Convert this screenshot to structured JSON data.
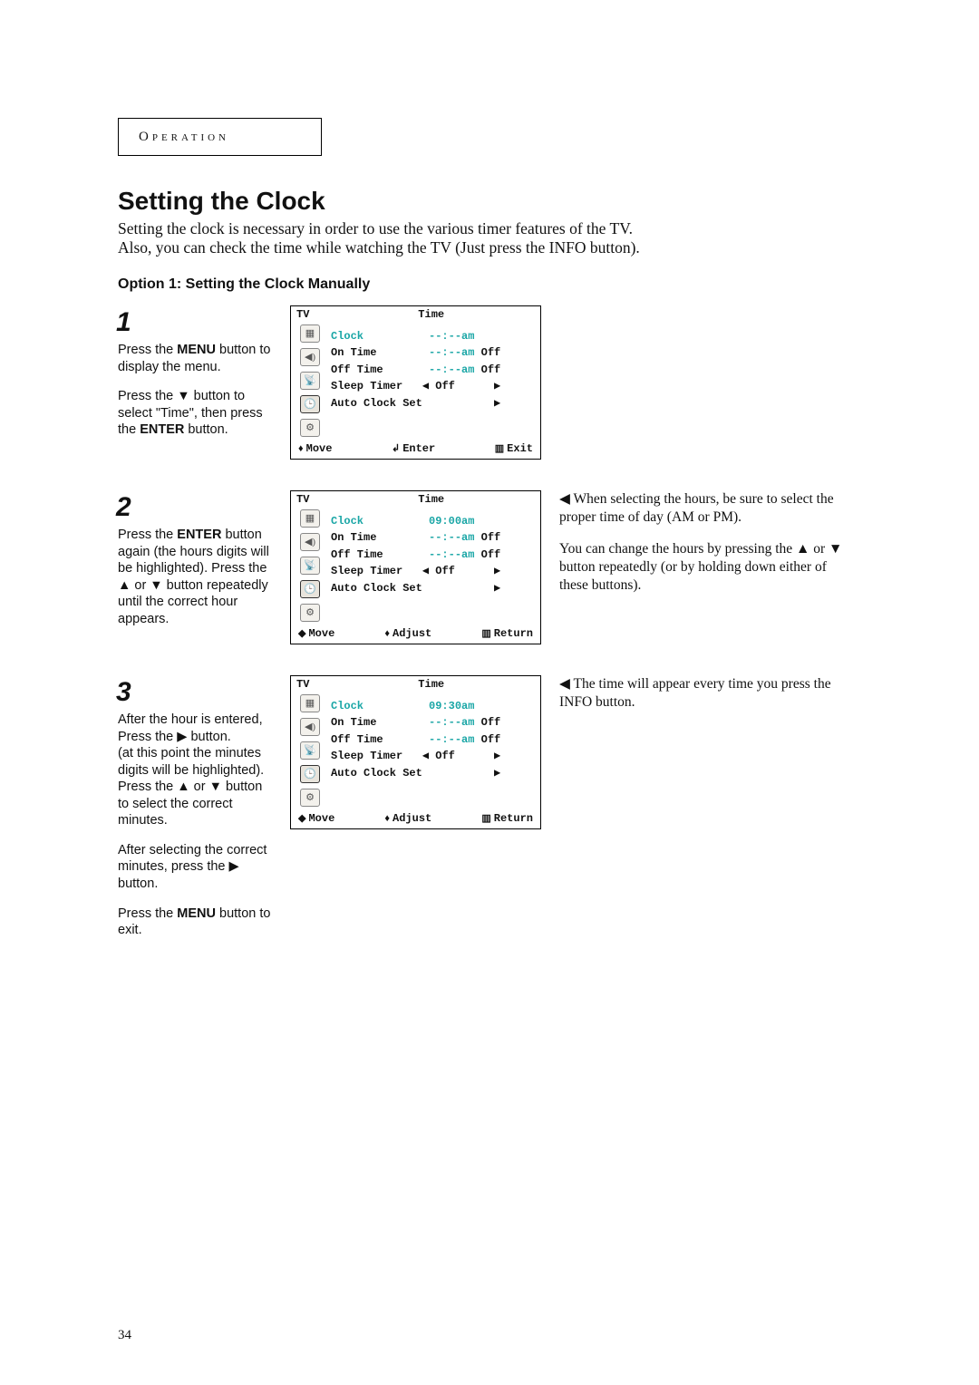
{
  "section_label": "Operation",
  "title": "Setting the Clock",
  "intro_line1": "Setting the clock is necessary in order to use the various timer features of the TV.",
  "intro_line2": "Also, you can check the time while watching the TV (Just press the INFO button).",
  "option_title": "Option 1: Setting the Clock Manually",
  "step1": {
    "num": "1",
    "p1a": "Press the ",
    "p1b": "MENU",
    "p1c": " button to display the menu.",
    "p2a": "Press the ▼ button to select \"Time\", then press the ",
    "p2b": "ENTER",
    "p2c": " button."
  },
  "osd1": {
    "tv": "TV",
    "head": "Time",
    "rows": "Clock          --:--am\nOn Time        --:--am Off\nOff Time       --:--am Off\nSleep Timer   ◀ Off      ▶\nAuto Clock Set           ▶",
    "foot_move_glyph": "♦",
    "foot_move": "Move",
    "foot_mid_glyph": "↲",
    "foot_mid": "Enter",
    "foot_right_glyph": "▥",
    "foot_right": "Exit"
  },
  "step2": {
    "num": "2",
    "p1a": "Press the ",
    "p1b": "ENTER",
    "p1c": " button again (the hours digits will be highlighted). Press the ▲ or ▼ button repeatedly until the correct hour appears."
  },
  "osd2": {
    "tv": "TV",
    "head": "Time",
    "rows": "Clock          09:00am\nOn Time        --:--am Off\nOff Time       --:--am Off\nSleep Timer   ◀ Off      ▶\nAuto Clock Set           ▶",
    "foot_move_glyph": "◆",
    "foot_move": "Move",
    "foot_mid_glyph": "♦",
    "foot_mid": "Adjust",
    "foot_right_glyph": "▥",
    "foot_right": "Return"
  },
  "note2a": "◀   When selecting the hours, be sure to select the proper time of day (AM or PM).",
  "note2b": "You can change the hours by pressing the ▲ or ▼ button repeatedly (or by holding down either of these buttons).",
  "step3": {
    "num": "3",
    "p1": "After the hour is entered, Press the ▶ button.",
    "p2": "(at this point the minutes digits will be highlighted). Press the ▲ or ▼ button to select the correct minutes.",
    "p3": "After selecting the correct minutes, press the ▶ button.",
    "p4a": "Press the ",
    "p4b": "MENU",
    "p4c": " button to exit."
  },
  "osd3": {
    "tv": "TV",
    "head": "Time",
    "rows": "Clock          09:30am\nOn Time        --:--am Off\nOff Time       --:--am Off\nSleep Timer   ◀ Off      ▶\nAuto Clock Set           ▶",
    "foot_move_glyph": "◆",
    "foot_move": "Move",
    "foot_mid_glyph": "♦",
    "foot_mid": "Adjust",
    "foot_right_glyph": "▥",
    "foot_right": "Return"
  },
  "note3": "◀   The time will appear every time you press the INFO button.",
  "page_number": "34"
}
